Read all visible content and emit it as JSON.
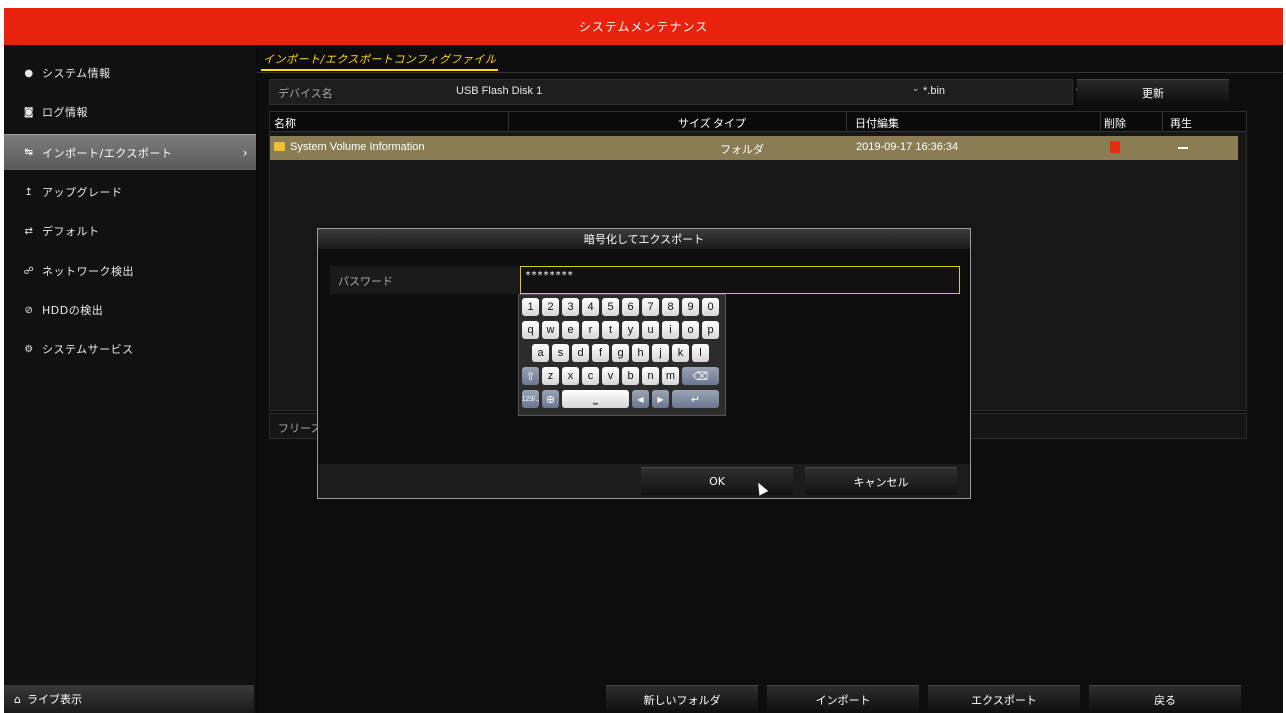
{
  "title": "システムメンテナンス",
  "sidebar": {
    "items": [
      {
        "icon": "info-icon",
        "glyph": "●",
        "label": "システム情報"
      },
      {
        "icon": "log-icon",
        "glyph": "◙",
        "label": "ログ情報"
      },
      {
        "icon": "import-export-icon",
        "glyph": "↹",
        "label": "インポート/エクスポート",
        "active": true
      },
      {
        "icon": "upgrade-icon",
        "glyph": "↥",
        "label": "アップグレード"
      },
      {
        "icon": "default-icon",
        "glyph": "⇄",
        "label": "デフォルト"
      },
      {
        "icon": "network-icon",
        "glyph": "☍",
        "label": "ネットワーク検出"
      },
      {
        "icon": "hdd-icon",
        "glyph": "⊘",
        "label": "HDDの検出"
      },
      {
        "icon": "service-icon",
        "glyph": "⚙",
        "label": "システムサービス"
      }
    ],
    "live_label": "ライブ表示"
  },
  "main": {
    "tab_label": "インポート/エクスポートコンフィグファイル",
    "device_label": "デバイス名",
    "device_value": "USB Flash Disk 1",
    "ext_value": "*.bin",
    "refresh_label": "更新",
    "columns": {
      "name": "名称",
      "size": "サイズ",
      "type": "タイプ",
      "date": "日付編集",
      "delete": "削除",
      "play": "再生"
    },
    "rows": [
      {
        "name": "System Volume Information",
        "size": "",
        "type": "フォルダ",
        "date": "2019-09-17 16:36:34"
      }
    ],
    "free_label": "フリース",
    "buttons": {
      "new_folder": "新しいフォルダ",
      "import": "インポート",
      "export": "エクスポート",
      "back": "戻る"
    }
  },
  "dialog": {
    "title": "暗号化してエクスポート",
    "password_label": "パスワード",
    "password_value": "********",
    "ok_label": "OK",
    "cancel_label": "キャンセル"
  },
  "keyboard": {
    "row1": [
      "1",
      "2",
      "3",
      "4",
      "5",
      "6",
      "7",
      "8",
      "9",
      "0"
    ],
    "row2": [
      "q",
      "w",
      "e",
      "r",
      "t",
      "y",
      "u",
      "i",
      "o",
      "p"
    ],
    "row3": [
      "a",
      "s",
      "d",
      "f",
      "g",
      "h",
      "j",
      "k",
      "l"
    ],
    "row4": [
      "z",
      "x",
      "c",
      "v",
      "b",
      "n",
      "m"
    ],
    "mode_key": "123/.,",
    "shift_icon": "shift-icon",
    "backspace_icon": "backspace-icon",
    "globe_icon": "globe-icon",
    "space_icon": "space-icon",
    "enter_icon": "enter-icon"
  },
  "colors": {
    "accent": "#e8220c",
    "highlight": "#ffd91a",
    "selected_row": "#8a7d54"
  }
}
